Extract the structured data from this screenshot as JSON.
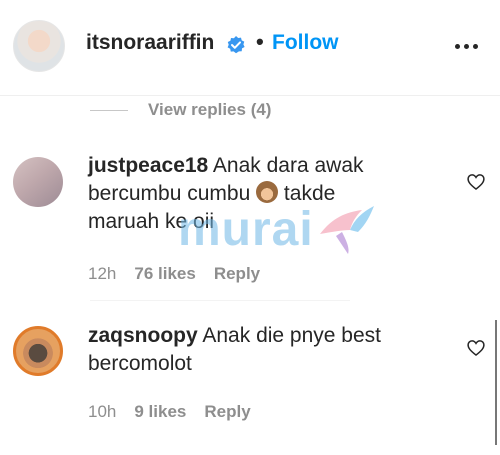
{
  "header": {
    "username": "itsnoraariffin",
    "separator": "•",
    "follow_label": "Follow"
  },
  "view_replies": "View replies (4)",
  "comments": [
    {
      "username": "justpeace18",
      "text_before": " Anak dara awak bercumbu cumbu ",
      "text_after": " takde maruah ke oii",
      "time": "12h",
      "likes": "76 likes",
      "reply": "Reply"
    },
    {
      "username": "zaqsnoopy",
      "text": " Anak die pnye best bercomolot",
      "time": "10h",
      "likes": "9 likes",
      "reply": "Reply"
    }
  ],
  "watermark": "murai",
  "colors": {
    "accent": "#0095f6",
    "muted": "#8e8e8e",
    "text": "#262626"
  }
}
